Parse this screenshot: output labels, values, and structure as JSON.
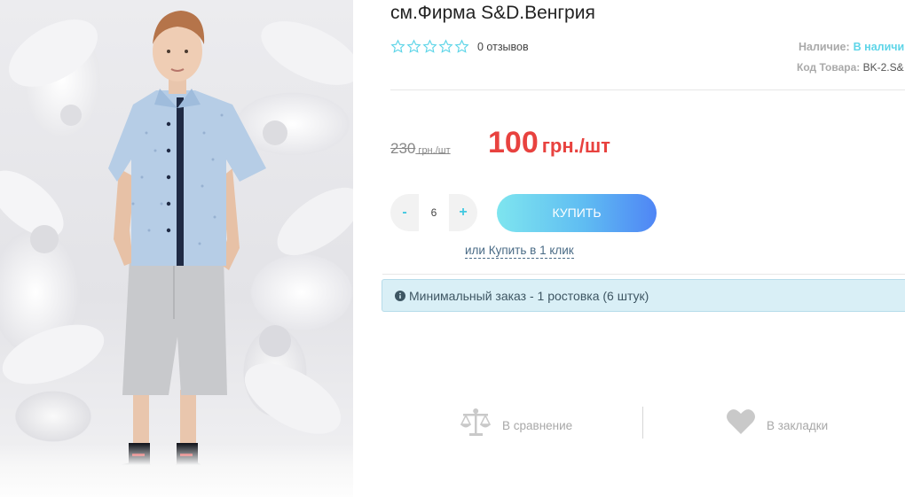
{
  "product": {
    "title": "см.Фирма S&D.Венгрия",
    "photo_alt": "boy in light blue shirt and grey shorts"
  },
  "rating": {
    "stars_filled": 0,
    "stars_total": 5,
    "reviews_text": "0 отзывов"
  },
  "availability": {
    "label": "Наличие:",
    "value": "В наличи"
  },
  "sku": {
    "label": "Код Товара:",
    "value": "BK-2.S&"
  },
  "price": {
    "old_value": "230",
    "old_unit": " грн./шт",
    "new_value": "100",
    "new_unit": "грн./шт"
  },
  "quantity": {
    "minus": "-",
    "value": "6",
    "plus": "+"
  },
  "buttons": {
    "buy": "КУПИТЬ",
    "one_click": "или Купить в 1 клик"
  },
  "notice": {
    "text": "Минимальный заказ - 1 ростовка (6 штук)"
  },
  "actions": {
    "compare": "В сравнение",
    "bookmark": "В закладки"
  },
  "colors": {
    "price_red": "#e8423f",
    "accent_cyan": "#41c8e0",
    "buy_gradient_start": "#7ee5ef",
    "buy_gradient_end": "#4f85f5",
    "notice_bg": "#d9eff6"
  }
}
